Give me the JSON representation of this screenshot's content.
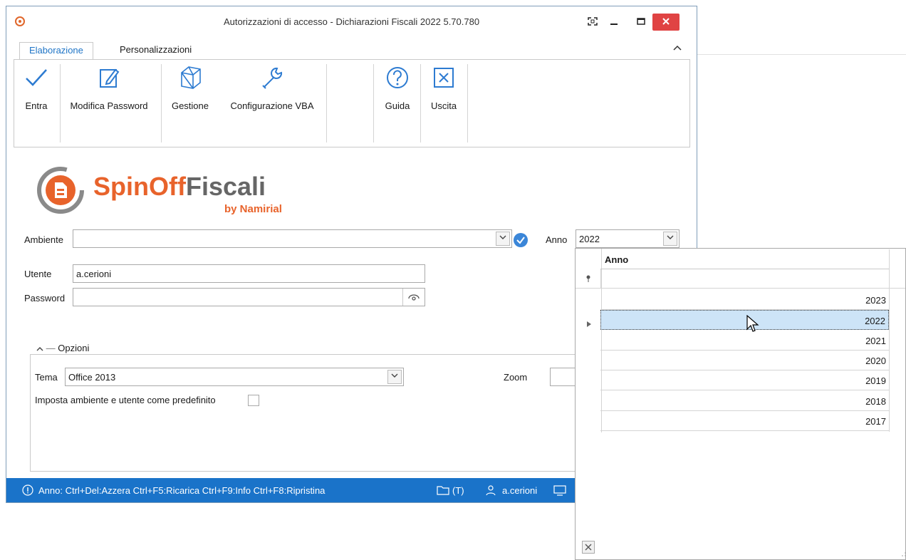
{
  "window": {
    "title": "Autorizzazioni di accesso - Dichiarazioni Fiscali 2022 5.70.780"
  },
  "tabs": [
    {
      "label": "Elaborazione"
    },
    {
      "label": "Personalizzazioni"
    }
  ],
  "ribbon": {
    "buttons": [
      {
        "label": "Entra",
        "icon": "check-icon"
      },
      {
        "label": "Modifica Password",
        "icon": "edit-icon"
      },
      {
        "label": "Gestione",
        "icon": "cube-icon"
      },
      {
        "label": "Configurazione VBA",
        "icon": "wrench-icon"
      },
      {
        "label": "Guida",
        "icon": "help-icon"
      },
      {
        "label": "Uscita",
        "icon": "exit-icon"
      }
    ]
  },
  "logo": {
    "name_part1": "SpinOff",
    "name_part2": "Fiscali",
    "tagline": "by Namirial",
    "color_orange": "#e8632b",
    "color_gray": "#666666"
  },
  "form": {
    "ambiente_label": "Ambiente",
    "ambiente_value": "",
    "anno_label": "Anno",
    "anno_value": "2022",
    "utente_label": "Utente",
    "utente_value": "a.cerioni",
    "password_label": "Password",
    "password_value": ""
  },
  "options": {
    "group_label": "Opzioni",
    "tema_label": "Tema",
    "tema_value": "Office 2013",
    "zoom_label": "Zoom",
    "predefinito_label": "Imposta ambiente e utente come predefinito",
    "predefinito_checked": false
  },
  "statusbar": {
    "shortcuts": "Anno: Ctrl+Del:Azzera  Ctrl+F5:Ricarica Ctrl+F9:Info Ctrl+F8:Ripristina",
    "mode": "(T)",
    "user": "a.cerioni",
    "color": "#1a73c9"
  },
  "dropdown": {
    "header": "Anno",
    "years": [
      "2023",
      "2022",
      "2021",
      "2020",
      "2019",
      "2018",
      "2017"
    ],
    "selected": "2022"
  }
}
